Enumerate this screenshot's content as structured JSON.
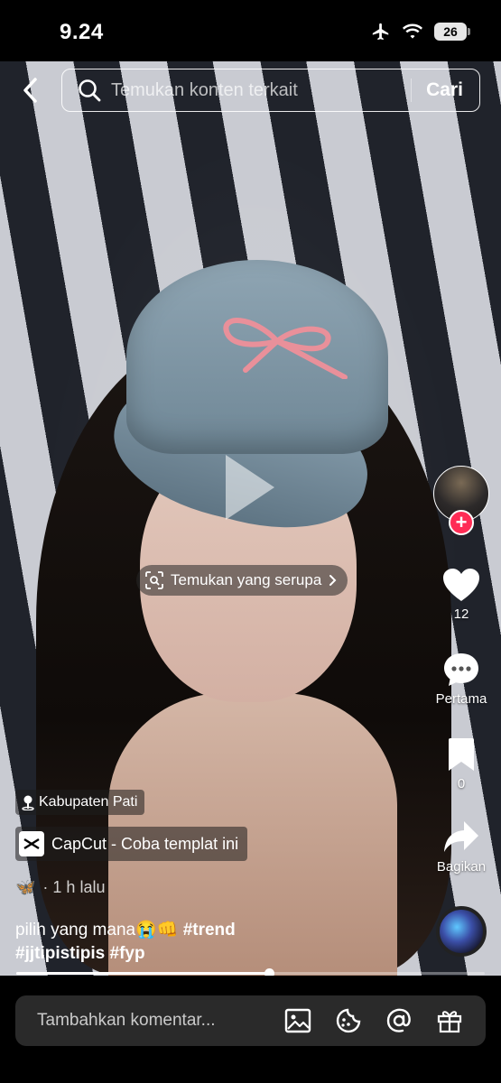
{
  "status_bar": {
    "time": "9.24",
    "battery": "26"
  },
  "search": {
    "placeholder": "Temukan konten terkait",
    "button_label": "Cari"
  },
  "similar": {
    "label": "Temukan yang serupa"
  },
  "actions": {
    "likes": "12",
    "comments_label": "Pertama",
    "saves": "0",
    "share_label": "Bagikan"
  },
  "post": {
    "location": "Kabupaten Pati",
    "capcut_label": "CapCut - Coba templat ini",
    "emoji": "🦋",
    "time_ago": "· 1 h lalu",
    "caption_text": "pilih yang mana😭👊 ",
    "hashtags": [
      "#trend",
      "#jjtipistipis",
      "#fyp"
    ]
  },
  "progress": {
    "fraction": 0.54
  },
  "comment": {
    "placeholder": "Tambahkan komentar..."
  },
  "colors": {
    "accent": "#fe2c55",
    "background": "#000000",
    "comment_box": "#2a2a2a"
  },
  "icons": [
    "back-chevron-icon",
    "search-icon",
    "airplane-icon",
    "wifi-icon",
    "battery-icon",
    "play-icon",
    "scan-icon",
    "heart-icon",
    "comment-bubble-icon",
    "bookmark-icon",
    "share-arrow-icon",
    "location-pin-icon",
    "capcut-logo-icon",
    "image-icon",
    "sticker-icon",
    "mention-icon",
    "gift-icon"
  ]
}
